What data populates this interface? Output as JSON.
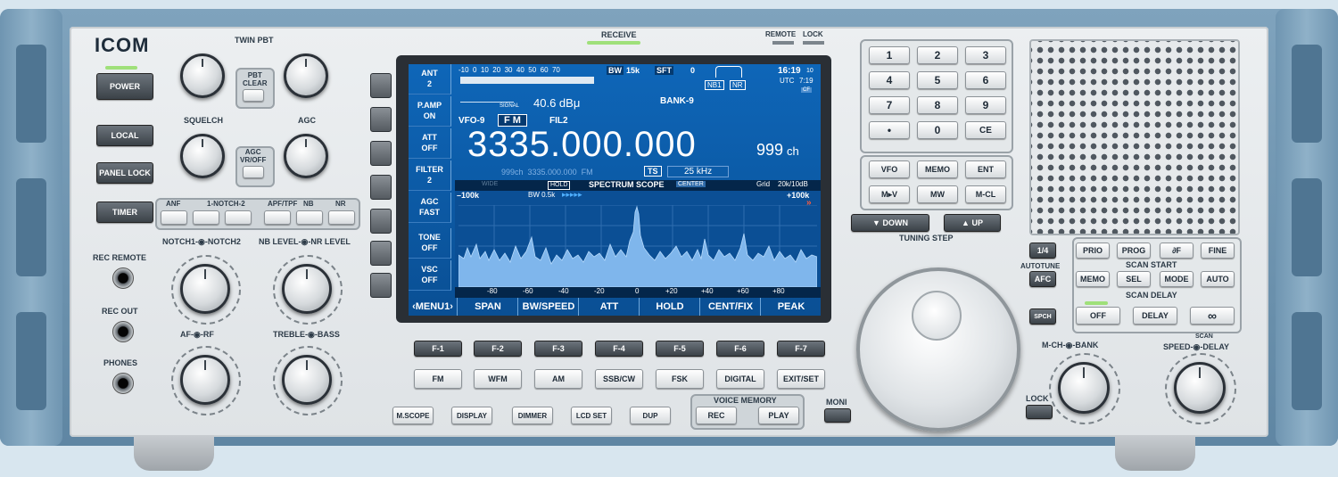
{
  "brand": "ICOM",
  "left": {
    "power": "POWER",
    "local": "LOCAL",
    "panel_lock": "PANEL LOCK",
    "timer": "TIMER",
    "twin_pbt": "TWIN PBT",
    "pbt_clear": "PBT\nCLEAR",
    "squelch": "SQUELCH",
    "agc": "AGC",
    "agc_vr_off": "AGC\nVR/OFF",
    "func_labels": [
      "ANF",
      "1-NOTCH-2",
      "APF/TPF",
      "NB",
      "NR"
    ],
    "rec_remote": "REC REMOTE",
    "rec_out": "REC OUT",
    "phones": "PHONES",
    "notch": "NOTCH1-◉-NOTCH2",
    "nb_nr": "NB LEVEL-◉-NR LEVEL",
    "af_rf": "AF-◉-RF",
    "treble_bass": "TREBLE-◉-BASS"
  },
  "top": {
    "receive": "RECEIVE",
    "remote": "REMOTE",
    "lock": "LOCK"
  },
  "lcd": {
    "side_keys": [
      {
        "l1": "ANT",
        "l2": "2"
      },
      {
        "l1": "P.AMP",
        "l2": "ON"
      },
      {
        "l1": "ATT",
        "l2": "OFF"
      },
      {
        "l1": "FILTER",
        "l2": "2"
      },
      {
        "l1": "AGC",
        "l2": "FAST"
      },
      {
        "l1": "TONE",
        "l2": "OFF"
      },
      {
        "l1": "VSC",
        "l2": "OFF"
      }
    ],
    "smeter_scale": "-10  0  10  20  30  40  50  60  70",
    "signal_label": "SIGNAL",
    "signal_value": "40.6 dBμ",
    "bw_label": "BW",
    "bw_value": "15k",
    "sft_label": "SFT",
    "sft_value": "0",
    "nb1": "NB1",
    "nr": "NR",
    "time": "16:19",
    "time_sec": "10",
    "utc_label": "UTC",
    "utc_time": "7:19",
    "cf": "CF",
    "bank": "BANK-9",
    "vfo": "VFO-9",
    "mode": "F M",
    "filter": "FIL2",
    "frequency": "3335.000.000",
    "channel": "999",
    "ch_unit": "ch",
    "sub_line": "999ch  3335.000.000  FM",
    "ts_label": "TS",
    "ts_value": "25 kHz",
    "scope": {
      "wide": "WIDE",
      "hold": "HOLD",
      "title": "SPECTRUM SCOPE",
      "center": "CENTER",
      "grid_label": "Grid",
      "grid_value": "20k/10dB",
      "span_left": "–100k",
      "span_right": "+100k",
      "bw": "BW 0.5k",
      "arrows": "▸▸▸▸▸",
      "fast": "»",
      "x_ticks": [
        "-80",
        "-60",
        "-40",
        "-20",
        "0",
        "+20",
        "+40",
        "+60",
        "+80"
      ]
    },
    "menu": [
      "‹MENU1›",
      "SPAN",
      "BW/SPEED",
      "ATT",
      "HOLD",
      "CENT/FIX",
      "PEAK"
    ]
  },
  "fkeys": [
    "F-1",
    "F-2",
    "F-3",
    "F-4",
    "F-5",
    "F-6",
    "F-7"
  ],
  "modes": [
    "FM",
    "WFM",
    "AM",
    "SSB/CW",
    "FSK",
    "DIGITAL",
    "EXIT/SET"
  ],
  "bottom": {
    "buttons": [
      "M.SCOPE",
      "DISPLAY",
      "DIMMER",
      "LCD SET",
      "DUP"
    ],
    "voice_memory": "VOICE MEMORY",
    "rec": "REC",
    "play": "PLAY",
    "moni": "MONI"
  },
  "keypad": [
    "1",
    "2",
    "3",
    "4",
    "5",
    "6",
    "7",
    "8",
    "9",
    "•",
    "0",
    "CE"
  ],
  "mem_keys": [
    "VFO",
    "MEMO",
    "ENT",
    "M▸V",
    "MW",
    "M-CL"
  ],
  "down": "▼ DOWN",
  "up": "▲ UP",
  "tuning_step": "TUNING STEP",
  "right": {
    "quarter": "1/4",
    "autotune": "AUTOTUNE",
    "afc": "AFC",
    "spch": "SPCH",
    "lock": "LOCK",
    "row1": [
      "PRIO",
      "PROG",
      "∂F",
      "FINE"
    ],
    "scan_start": "SCAN START",
    "row2": [
      "MEMO",
      "SEL",
      "MODE",
      "AUTO"
    ],
    "scan_delay": "SCAN DELAY",
    "row3": [
      "OFF",
      "DELAY",
      "∞"
    ],
    "mch_bank": "M-CH-◉-BANK",
    "scan": "SCAN",
    "speed_delay": "SPEED-◉-DELAY"
  },
  "colors": {
    "lcd": "#0e66b8",
    "led": "#9fe07a",
    "rack": "#6f95b1"
  }
}
